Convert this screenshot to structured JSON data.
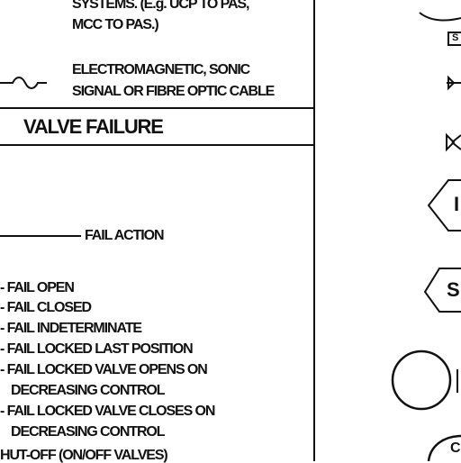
{
  "legend": {
    "comm_lines": [
      "SYSTEMS. (E.g. UCP TO PAS,",
      "MCC TO PAS.)"
    ],
    "em_lines": [
      "ELECTROMAGNETIC, SONIC",
      "SIGNAL OR FIBRE OPTIC CABLE"
    ]
  },
  "valve_failure": {
    "header": "VALVE FAILURE",
    "fail_action_label": "FAIL ACTION",
    "items": [
      "- FAIL OPEN",
      "- FAIL CLOSED",
      "- FAIL INDETERMINATE",
      "- FAIL LOCKED LAST POSITION",
      "- FAIL LOCKED VALVE OPENS ON",
      "DECREASING CONTROL",
      "- FAIL LOCKED VALVE CLOSES ON",
      "DECREASING CONTROL",
      "HUT-OFF (ON/OFF VALVES)"
    ]
  },
  "right_symbols": {
    "tag_s_small": "S",
    "hex_left_letter": "I",
    "hex_right_letter": "S",
    "bottom_letter": "C"
  }
}
